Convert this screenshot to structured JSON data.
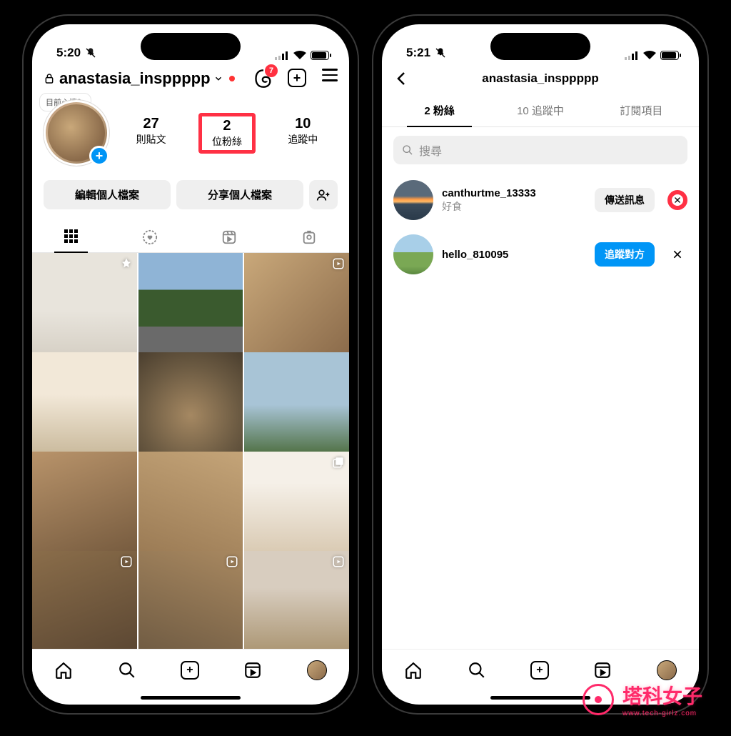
{
  "watermark": {
    "brand": "塔科女子",
    "url": "www.tech-girlz.com"
  },
  "left": {
    "status": {
      "time": "5:20"
    },
    "header": {
      "username": "anastasia_insppppp",
      "threads_badge": "7"
    },
    "profile": {
      "mood_prompt": "目前心情？",
      "stats": {
        "posts": {
          "value": "27",
          "label": "則貼文"
        },
        "followers": {
          "value": "2",
          "label": "位粉絲"
        },
        "following": {
          "value": "10",
          "label": "追蹤中"
        }
      },
      "actions": {
        "edit": "編輯個人檔案",
        "share": "分享個人檔案"
      }
    },
    "grid_markers": {
      "pin": "pin",
      "reel": "reel",
      "multi": "multi"
    }
  },
  "right": {
    "status": {
      "time": "5:21"
    },
    "header": {
      "title": "anastasia_insppppp"
    },
    "tabs": {
      "followers": "2 粉絲",
      "following": "10 追蹤中",
      "subscriptions": "訂閱項目"
    },
    "search": {
      "placeholder": "搜尋"
    },
    "rows": [
      {
        "username": "canthurtme_13333",
        "subtitle": "好食",
        "button": "傳送訊息",
        "button_style": "grey",
        "highlight_x": true
      },
      {
        "username": "hello_810095",
        "subtitle": "",
        "button": "追蹤對方",
        "button_style": "blue",
        "highlight_x": false
      }
    ]
  }
}
